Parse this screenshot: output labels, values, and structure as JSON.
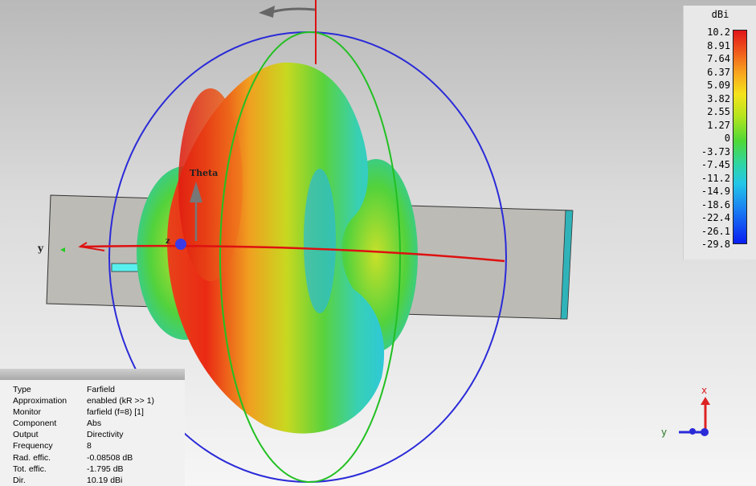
{
  "legend": {
    "unit": "dBi",
    "ticks": [
      "10.2",
      "8.91",
      "7.64",
      "6.37",
      "5.09",
      "3.82",
      "2.55",
      "1.27",
      "0",
      "-3.73",
      "-7.45",
      "-11.2",
      "-14.9",
      "-18.6",
      "-22.4",
      "-26.1",
      "-29.8"
    ]
  },
  "scene": {
    "theta_label": "Theta",
    "y_axis_label": "y",
    "z_axis_label": "z"
  },
  "triad": {
    "x_label": "x",
    "y_label": "y"
  },
  "info": {
    "rows": [
      {
        "key": "Type",
        "value": "Farfield"
      },
      {
        "key": "Approximation",
        "value": "enabled (kR >> 1)"
      },
      {
        "key": "Monitor",
        "value": "farfield (f=8) [1]"
      },
      {
        "key": "Component",
        "value": "Abs"
      },
      {
        "key": "Output",
        "value": "Directivity"
      },
      {
        "key": "Frequency",
        "value": "8"
      },
      {
        "key": "Rad. effic.",
        "value": "-0.08508 dB"
      },
      {
        "key": "Tot. effic.",
        "value": "-1.795 dB"
      },
      {
        "key": "Dir.",
        "value": "10.19 dBi"
      }
    ]
  },
  "colors": {
    "phi_circle": "#2a2ad8",
    "theta_circle": "#22c022",
    "y_axis": "#dd1111",
    "substrate": "#bdbbb6"
  }
}
